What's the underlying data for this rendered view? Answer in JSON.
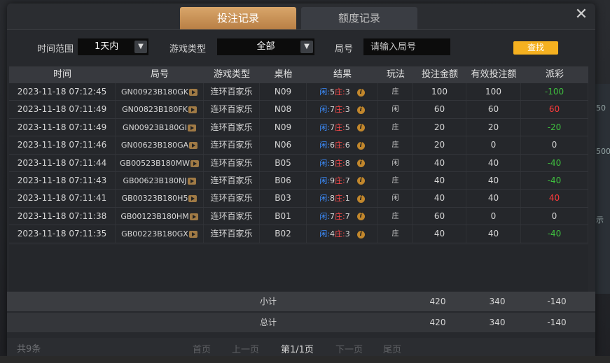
{
  "tabs": {
    "bet_records": "投注记录",
    "limit_records": "额度记录"
  },
  "close_symbol": "✕",
  "filters": {
    "time_label": "时间范围",
    "time_value": "1天内",
    "game_label": "游戏类型",
    "game_value": "全部",
    "round_label": "局号",
    "round_placeholder": "请输入局号",
    "search_label": "查找"
  },
  "table": {
    "headers": [
      "时间",
      "局号",
      "游戏类型",
      "桌枱",
      "结果",
      "玩法",
      "投注金额",
      "有效投注额",
      "派彩"
    ],
    "rows": [
      {
        "time": "2023-11-18 07:12:45",
        "round": "GN00923B180GK",
        "game": "连环百家乐",
        "table": "N09",
        "p_label": "闲:",
        "p_val": "5",
        "b_label": "庄:",
        "b_val": "3",
        "play": "庄",
        "bet": "100",
        "valid": "100",
        "payout": "-100",
        "sign": "neg"
      },
      {
        "time": "2023-11-18 07:11:49",
        "round": "GN00823B180FK",
        "game": "连环百家乐",
        "table": "N08",
        "p_label": "闲:",
        "p_val": "7",
        "b_label": "庄:",
        "b_val": "3",
        "play": "闲",
        "bet": "60",
        "valid": "60",
        "payout": "60",
        "sign": "pos"
      },
      {
        "time": "2023-11-18 07:11:49",
        "round": "GN00923B180GI",
        "game": "连环百家乐",
        "table": "N09",
        "p_label": "闲:",
        "p_val": "7",
        "b_label": "庄:",
        "b_val": "5",
        "play": "庄",
        "bet": "20",
        "valid": "20",
        "payout": "-20",
        "sign": "neg"
      },
      {
        "time": "2023-11-18 07:11:46",
        "round": "GN00623B180GA",
        "game": "连环百家乐",
        "table": "N06",
        "p_label": "闲:",
        "p_val": "6",
        "b_label": "庄:",
        "b_val": "6",
        "play": "庄",
        "bet": "20",
        "valid": "0",
        "payout": "0",
        "sign": "zero"
      },
      {
        "time": "2023-11-18 07:11:44",
        "round": "GB00523B180MW",
        "game": "连环百家乐",
        "table": "B05",
        "p_label": "闲:",
        "p_val": "3",
        "b_label": "庄:",
        "b_val": "8",
        "play": "闲",
        "bet": "40",
        "valid": "40",
        "payout": "-40",
        "sign": "neg"
      },
      {
        "time": "2023-11-18 07:11:43",
        "round": "GB00623B180NJ",
        "game": "连环百家乐",
        "table": "B06",
        "p_label": "闲:",
        "p_val": "9",
        "b_label": "庄:",
        "b_val": "7",
        "play": "庄",
        "bet": "40",
        "valid": "40",
        "payout": "-40",
        "sign": "neg"
      },
      {
        "time": "2023-11-18 07:11:41",
        "round": "GB00323B180H5",
        "game": "连环百家乐",
        "table": "B03",
        "p_label": "闲:",
        "p_val": "8",
        "b_label": "庄:",
        "b_val": "1",
        "play": "闲",
        "bet": "40",
        "valid": "40",
        "payout": "40",
        "sign": "pos"
      },
      {
        "time": "2023-11-18 07:11:38",
        "round": "GB00123B180HM",
        "game": "连环百家乐",
        "table": "B01",
        "p_label": "闲:",
        "p_val": "7",
        "b_label": "庄:",
        "b_val": "7",
        "play": "庄",
        "bet": "60",
        "valid": "0",
        "payout": "0",
        "sign": "zero"
      },
      {
        "time": "2023-11-18 07:11:35",
        "round": "GB00223B180GX",
        "game": "连环百家乐",
        "table": "B02",
        "p_label": "闲:",
        "p_val": "4",
        "b_label": "庄:",
        "b_val": "3",
        "play": "庄",
        "bet": "40",
        "valid": "40",
        "payout": "-40",
        "sign": "neg"
      }
    ]
  },
  "subtotal": {
    "label": "小计",
    "bet": "420",
    "valid": "340",
    "payout": "-140"
  },
  "total": {
    "label": "总计",
    "bet": "420",
    "valid": "340",
    "payout": "-140"
  },
  "footer": {
    "count": "共9条",
    "first": "首页",
    "prev": "上一页",
    "current": "第1/1页",
    "next": "下一页",
    "last": "尾页"
  },
  "background": {
    "chip1": "50",
    "chip2": "500",
    "side_text": "示"
  },
  "colors": {
    "tab_active": "#c8925a",
    "search_button": "#f5b120",
    "negative": "#3fbf3f",
    "positive": "#ff3b3b",
    "player": "#3c8dff",
    "banker": "#ff4a4a"
  }
}
